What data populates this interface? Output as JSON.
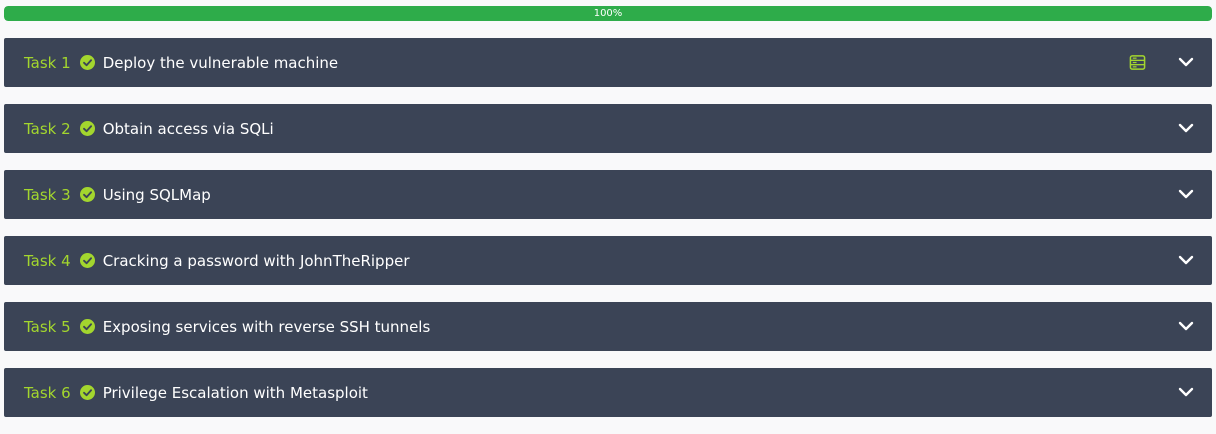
{
  "progress": {
    "label": "100%",
    "percent": 100
  },
  "colors": {
    "progress_fill": "#2eac4a",
    "task_bg": "#3b4456",
    "task_number": "#a3d62e",
    "check": "#a3d62e",
    "title": "#ffffff"
  },
  "tasks": [
    {
      "number": "Task 1",
      "title": "Deploy the vulnerable machine",
      "completed": true,
      "icons": [
        "check-circle-icon",
        "server-icon",
        "chevron-down-icon"
      ]
    },
    {
      "number": "Task 2",
      "title": "Obtain access via SQLi",
      "completed": true,
      "icons": [
        "check-circle-icon",
        "chevron-down-icon"
      ]
    },
    {
      "number": "Task 3",
      "title": "Using SQLMap",
      "completed": true,
      "icons": [
        "check-circle-icon",
        "chevron-down-icon"
      ]
    },
    {
      "number": "Task 4",
      "title": "Cracking a password with JohnTheRipper",
      "completed": true,
      "icons": [
        "check-circle-icon",
        "chevron-down-icon"
      ]
    },
    {
      "number": "Task 5",
      "title": "Exposing services with reverse SSH tunnels",
      "completed": true,
      "icons": [
        "check-circle-icon",
        "chevron-down-icon"
      ]
    },
    {
      "number": "Task 6",
      "title": "Privilege Escalation with Metasploit",
      "completed": true,
      "icons": [
        "check-circle-icon",
        "chevron-down-icon"
      ]
    }
  ]
}
